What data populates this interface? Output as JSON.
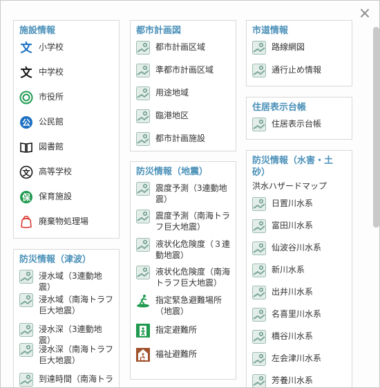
{
  "close_icon": "×",
  "facilities": {
    "title": "施設情報",
    "items": [
      {
        "label": "小学校",
        "icon": "elementary-school-icon"
      },
      {
        "label": "中学校",
        "icon": "junior-high-school-icon"
      },
      {
        "label": "市役所",
        "icon": "city-hall-icon"
      },
      {
        "label": "公民館",
        "icon": "community-center-icon"
      },
      {
        "label": "図書館",
        "icon": "library-icon"
      },
      {
        "label": "高等学校",
        "icon": "high-school-icon"
      },
      {
        "label": "保育施設",
        "icon": "nursery-icon"
      },
      {
        "label": "廃棄物処理場",
        "icon": "waste-facility-icon"
      }
    ]
  },
  "tsunami": {
    "title": "防災情報（津波）",
    "items": [
      {
        "label": "浸水域（3連動地震）"
      },
      {
        "label": "浸水域（南海トラフ巨大地震）"
      },
      {
        "label": "浸水深（3連動地震）"
      },
      {
        "label": "浸水深（南海トラフ巨大地震）"
      },
      {
        "label": "到達時間（南海トラ"
      }
    ]
  },
  "urban_planning": {
    "title": "都市計画図",
    "items": [
      {
        "label": "都市計画区域"
      },
      {
        "label": "準都市計画区域"
      },
      {
        "label": "用途地域"
      },
      {
        "label": "臨港地区"
      },
      {
        "label": "都市計画施設"
      }
    ]
  },
  "earthquake": {
    "title": "防災情報（地震）",
    "items": [
      {
        "label": "震度予測（3連動地震）",
        "icon": "map-layer-icon"
      },
      {
        "label": "震度予測（南海トラフ巨大地震）",
        "icon": "map-layer-icon"
      },
      {
        "label": "液状化危険度（３連動地震）",
        "icon": "map-layer-icon"
      },
      {
        "label": "液状化危険度（南海トラフ巨大地震）",
        "icon": "map-layer-icon"
      },
      {
        "label": "指定緊急避難場所（地震）",
        "icon": "evacuation-site-icon"
      },
      {
        "label": "指定避難所",
        "icon": "shelter-icon"
      },
      {
        "label": "福祉避難所",
        "icon": "welfare-shelter-icon"
      }
    ]
  },
  "city_roads": {
    "title": "市道情報",
    "items": [
      {
        "label": "路線網図"
      },
      {
        "label": "通行止め情報"
      }
    ]
  },
  "address": {
    "title": "住居表示台帳",
    "items": [
      {
        "label": "住居表示台帳"
      }
    ]
  },
  "flood": {
    "title": "防災情報（水害・土砂）",
    "subtitle": "洪水ハザードマップ",
    "items": [
      {
        "label": "日置川水系"
      },
      {
        "label": "富田川水系"
      },
      {
        "label": "仙波谷川水系"
      },
      {
        "label": "新川水系"
      },
      {
        "label": "出井川水系"
      },
      {
        "label": "名喜里川水系"
      },
      {
        "label": "橋谷川水系"
      },
      {
        "label": "左会津川水系"
      },
      {
        "label": "芳養川水系"
      }
    ]
  },
  "colors": {
    "title": "#4a90b8",
    "map_icon": "#7da79b",
    "school_blue": "#1a6fc2",
    "green": "#1f9a4f",
    "red": "#d9352b"
  }
}
